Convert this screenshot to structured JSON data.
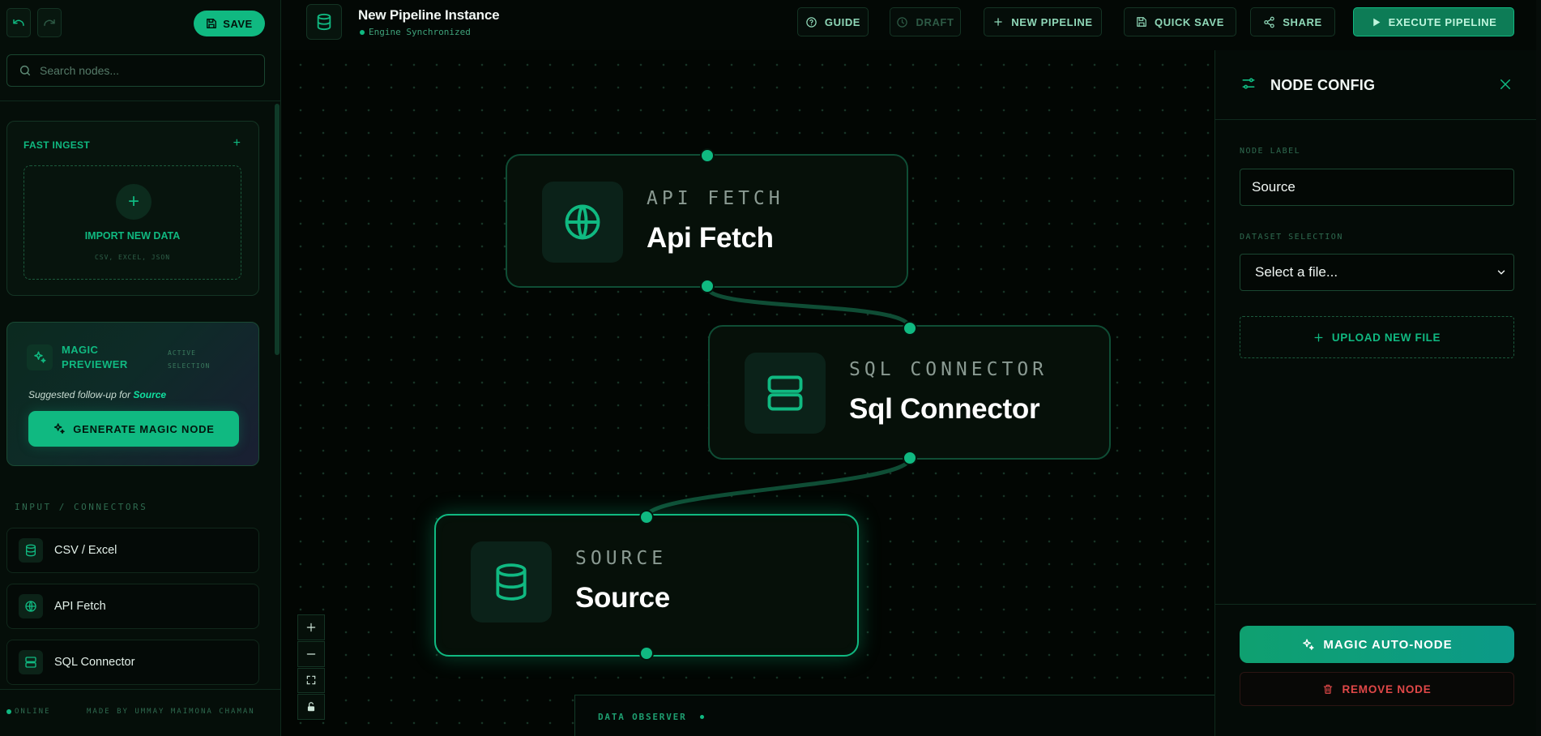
{
  "app": {
    "save_label": "SAVE",
    "search_placeholder": "Search nodes..."
  },
  "fast_ingest": {
    "title": "FAST INGEST",
    "plus": "+",
    "import_label": "IMPORT NEW DATA",
    "formats": "CSV, EXCEL, JSON"
  },
  "magic_previewer": {
    "title_line1": "MAGIC",
    "title_line2": "PREVIEWER",
    "tag_line1": "ACTIVE",
    "tag_line2": "SELECTION",
    "suggest_prefix": "Suggested follow-up for",
    "suggest_target": "Source",
    "button_label": "GENERATE MAGIC NODE"
  },
  "library": {
    "section_label": "INPUT / CONNECTORS",
    "items": [
      {
        "label": "CSV / Excel",
        "icon": "database-icon"
      },
      {
        "label": "API Fetch",
        "icon": "globe-icon"
      },
      {
        "label": "SQL Connector",
        "icon": "server-icon"
      }
    ]
  },
  "footer": {
    "status": "ONLINE",
    "credit": "MADE BY UMMAY MAIMONA CHAMAN"
  },
  "header": {
    "title": "New Pipeline Instance",
    "status": "Engine Synchronized",
    "buttons": {
      "guide": "GUIDE",
      "draft": "DRAFT",
      "new_pipeline": "NEW PIPELINE",
      "quick_save": "QUICK SAVE",
      "share": "SHARE",
      "execute": "EXECUTE PIPELINE"
    }
  },
  "nodes": [
    {
      "type": "API FETCH",
      "name": "Api Fetch",
      "icon": "globe-icon"
    },
    {
      "type": "SQL CONNECTOR",
      "name": "Sql Connector",
      "icon": "server-icon"
    },
    {
      "type": "SOURCE",
      "name": "Source",
      "icon": "database-icon",
      "selected": true
    }
  ],
  "observer": {
    "label": "DATA OBSERVER"
  },
  "config": {
    "title": "NODE CONFIG",
    "node_label_title": "NODE LABEL",
    "node_label_value": "Source",
    "dataset_title": "DATASET SELECTION",
    "dataset_value": "Select a file...",
    "upload_label": "UPLOAD NEW FILE",
    "auto_node_label": "MAGIC AUTO-NODE",
    "remove_label": "REMOVE NODE"
  },
  "colors": {
    "accent": "#10b981",
    "danger": "#e04848",
    "background": "#030805"
  }
}
